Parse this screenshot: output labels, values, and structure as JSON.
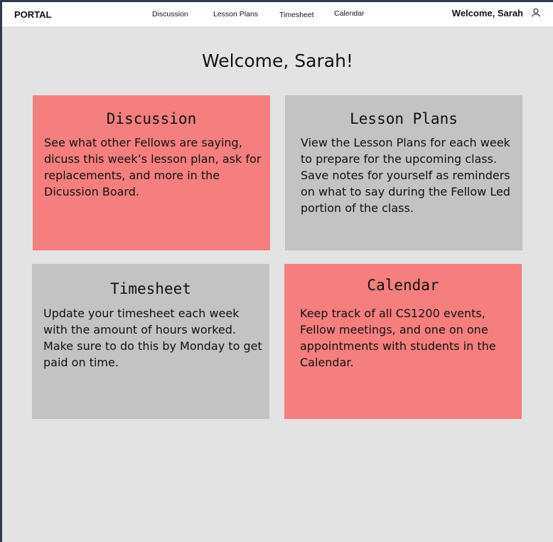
{
  "header": {
    "brand": "PORTAL",
    "nav": {
      "discussion": "Discussion",
      "lesson_plans": "Lesson Plans",
      "timesheet": "Timesheet",
      "calendar": "Calendar"
    },
    "welcome": "Welcome, Sarah",
    "user_icon": "user-icon"
  },
  "main": {
    "title": "Welcome, Sarah!",
    "cards": [
      {
        "title": "Discussion",
        "text": "See what other Fellows are saying, dicuss this week’s lesson plan, ask for replacements, and more in the Dicussion Board.",
        "color": "#f57f7e"
      },
      {
        "title": "Lesson Plans",
        "text": "View the Lesson Plans for each week to prepare for the upcoming class. Save notes for yourself as reminders on what to say during the Fellow Led portion of the class.",
        "color": "#c3c3c3"
      },
      {
        "title": "Timesheet",
        "text": "Update your timesheet each week with the amount of hours worked. Make sure to do this by Monday to get paid on time.",
        "color": "#c3c3c3"
      },
      {
        "title": "Calendar",
        "text": "Keep track of all CS1200 events, Fellow meetings, and one on one appointments with students in the Calendar.",
        "color": "#f57f7e"
      }
    ]
  }
}
